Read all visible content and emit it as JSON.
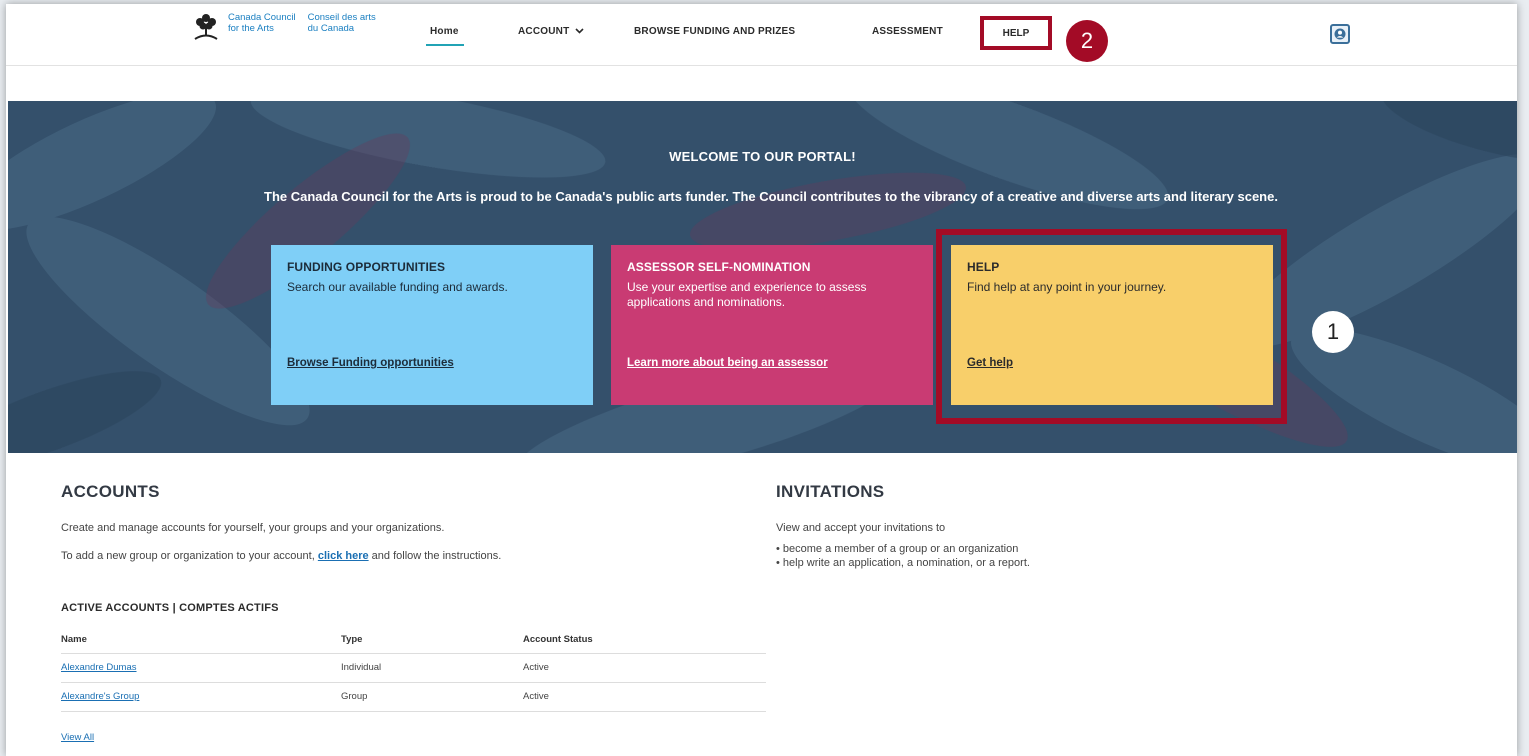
{
  "logo": {
    "en_line1": "Canada Council",
    "en_line2": "for the Arts",
    "fr_line1": "Conseil des arts",
    "fr_line2": "du Canada"
  },
  "nav": {
    "home": "Home",
    "account": "ACCOUNT",
    "browse": "BROWSE FUNDING AND PRIZES",
    "assessment": "ASSESSMENT",
    "help": "HELP"
  },
  "markers": {
    "one": "1",
    "two": "2"
  },
  "hero": {
    "title": "WELCOME TO OUR PORTAL!",
    "description": "The Canada Council for the Arts is proud to be Canada's public arts funder. The Council contributes to the vibrancy of a creative and diverse arts and literary scene."
  },
  "cards": {
    "funding": {
      "title": "FUNDING OPPORTUNITIES",
      "text": "Search our available funding and awards.",
      "link": "Browse Funding opportunities"
    },
    "assessor": {
      "title": "ASSESSOR SELF-NOMINATION",
      "text": "Use your expertise and experience to assess applications and nominations.",
      "link": "Learn more about being an assessor"
    },
    "help": {
      "title": "HELP",
      "text": "Find help at any point in your journey.",
      "link": "Get help"
    }
  },
  "accounts": {
    "title": "ACCOUNTS",
    "line1": "Create and manage accounts for yourself, your groups and your organizations.",
    "line2_before": "To add a new group or organization to your account, ",
    "line2_link": "click here",
    "line2_after": " and follow the instructions.",
    "active_title": "ACTIVE ACCOUNTS | COMPTES ACTIFS",
    "columns": [
      "Name",
      "Type",
      "Account Status"
    ],
    "rows": [
      {
        "name": "Alexandre Dumas",
        "type": "Individual",
        "status": "Active"
      },
      {
        "name": "Alexandre's Group",
        "type": "Group",
        "status": "Active"
      }
    ],
    "view_all": "View All"
  },
  "invitations": {
    "title": "INVITATIONS",
    "line1": "View and accept your invitations to",
    "bullet1": "• become a member of a group or an organization",
    "bullet2": "• help write an application, a nomination, or a report."
  },
  "colors": {
    "highlight": "#a30b26",
    "hero_bg": "#34506b",
    "card_funding": "#7fcff7",
    "card_assessor": "#c93b73",
    "card_help": "#f8cf6a",
    "link": "#1a6fb3",
    "nav_active": "#21a3b5"
  },
  "icons": {
    "logo": "tree-logo-icon",
    "account_chevron": "chevron-down-icon",
    "avatar": "user-avatar-icon"
  }
}
